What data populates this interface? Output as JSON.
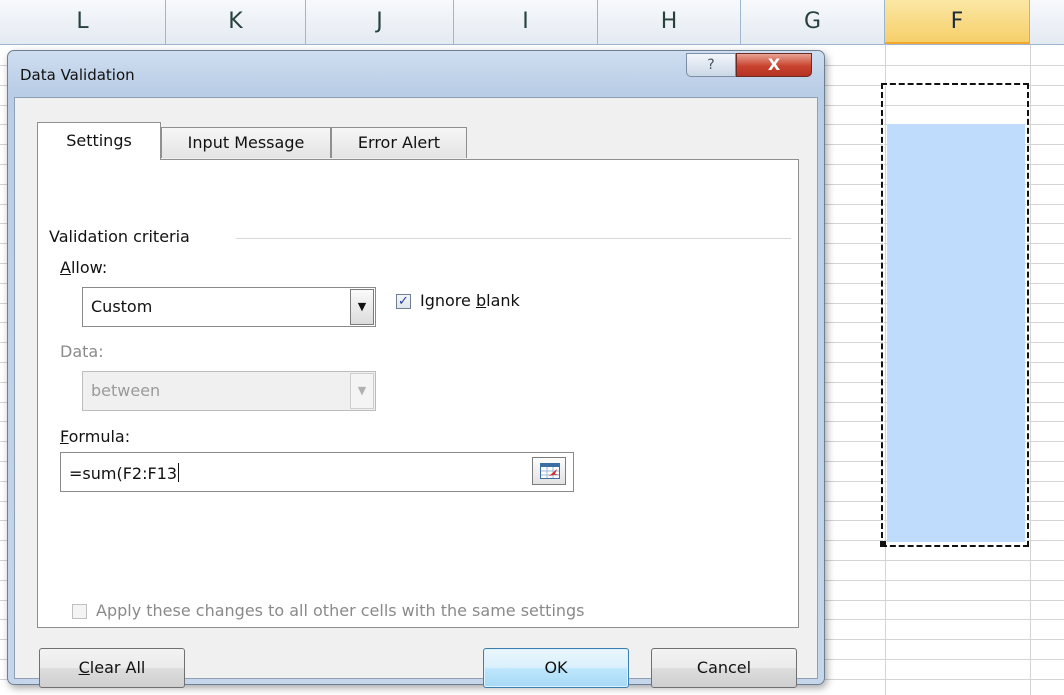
{
  "spreadsheet": {
    "columns": [
      {
        "label": "L",
        "selected": false
      },
      {
        "label": "K",
        "selected": false
      },
      {
        "label": "J",
        "selected": false
      },
      {
        "label": "I",
        "selected": false
      },
      {
        "label": "H",
        "selected": false
      },
      {
        "label": "G",
        "selected": false
      },
      {
        "label": "F",
        "selected": true
      }
    ],
    "selection_color": "#bfdcfc",
    "header_highlight_color": "#f6cf6a"
  },
  "dialog": {
    "title": "Data Validation",
    "help_label": "?",
    "close_label": "X",
    "tabs": [
      {
        "label": "Settings",
        "active": true
      },
      {
        "label": "Input Message",
        "active": false
      },
      {
        "label": "Error Alert",
        "active": false
      }
    ],
    "settings": {
      "section_label": "Validation criteria",
      "allow_label_mnemonic": "A",
      "allow_label_rest": "llow:",
      "allow_value": "Custom",
      "ignore_blank_prefix": "Ignore ",
      "ignore_blank_mnemonic": "b",
      "ignore_blank_suffix": "lank",
      "ignore_blank_checked": true,
      "data_label": "Data:",
      "data_value": "between",
      "formula_label_mnemonic": "F",
      "formula_label_rest": "ormula:",
      "formula_value": "=sum(F2:F13",
      "apply_all_label": "Apply these changes to all other cells with the same settings",
      "apply_all_checked": false
    },
    "buttons": {
      "clear_all_mnemonic": "C",
      "clear_all_rest": "lear All",
      "ok": "OK",
      "cancel": "Cancel"
    },
    "icons": {
      "ref_button": "collapse-dialog-icon",
      "dropdown": "chevron-down-icon",
      "checkbox_check": "checkmark-icon"
    }
  }
}
